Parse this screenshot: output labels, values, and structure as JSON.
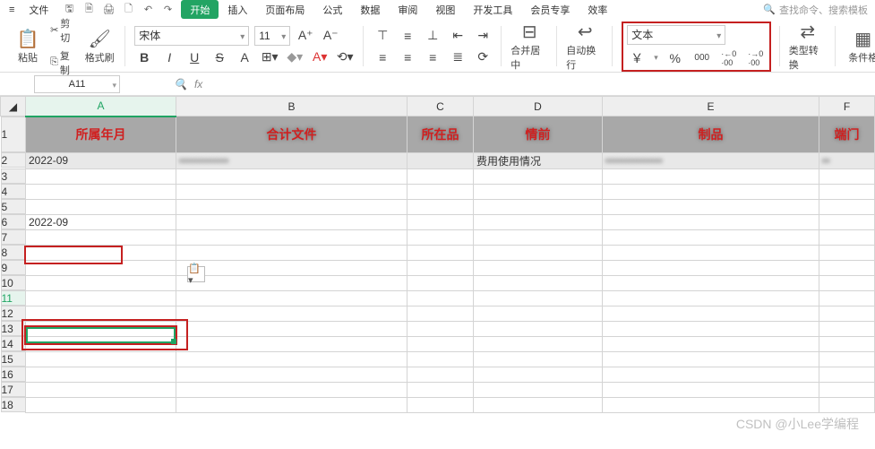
{
  "menu": {
    "hamburger": "≡",
    "file": "文件",
    "qat": [
      "save",
      "saveas",
      "print",
      "preview",
      "undo",
      "redo"
    ],
    "tabs": [
      "开始",
      "插入",
      "页面布局",
      "公式",
      "数据",
      "审阅",
      "视图",
      "开发工具",
      "会员专享",
      "效率"
    ],
    "active_tab": "开始",
    "search_placeholder": "查找命令、搜索模板"
  },
  "ribbon": {
    "paste": "粘贴",
    "cut": "剪切",
    "copy": "复制",
    "format_painter": "格式刷",
    "font_name": "宋体",
    "font_size": "11",
    "bold": "B",
    "italic": "I",
    "underline": "U",
    "strike": "S",
    "merge": "合并居中",
    "wrap": "自动换行",
    "number_format": "文本",
    "currency": "￥",
    "percent": "%",
    "thousands": "000",
    "inc_dec": "←0",
    "inc_dec2": "→0",
    "type_convert": "类型转换",
    "cond_format": "条件格"
  },
  "fx": {
    "namebox": "A11",
    "fx_label": "fx"
  },
  "cols": [
    "A",
    "B",
    "C",
    "D",
    "E",
    "F"
  ],
  "rows": [
    "1",
    "2",
    "3",
    "4",
    "5",
    "6",
    "7",
    "8",
    "9",
    "10",
    "11",
    "12",
    "13",
    "14",
    "15",
    "16",
    "17",
    "18"
  ],
  "headers": {
    "A": "所属年月",
    "B": "合计文件",
    "C": "所在品",
    "D": "情前",
    "E": "制品",
    "F": "端门"
  },
  "cells": {
    "A2": "2022-09",
    "D2": "费用使用情况",
    "A6": "2022-09"
  },
  "watermark": "CSDN @小Lee学编程"
}
